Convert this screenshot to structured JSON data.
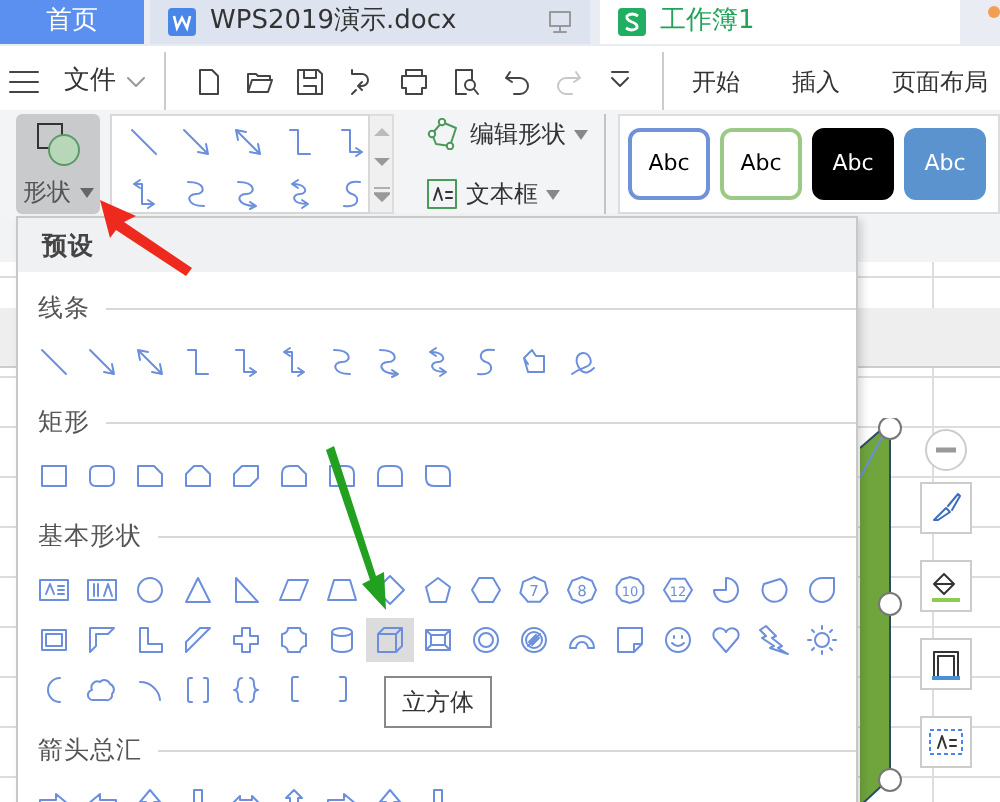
{
  "tabs": [
    {
      "label": "首页",
      "kind": "home",
      "selected": false
    },
    {
      "label": "WPS2019演示.docx",
      "kind": "writer",
      "selected": false
    },
    {
      "label": "工作簿1",
      "kind": "sheet",
      "selected": true
    }
  ],
  "toolbar": {
    "menu_label": "文件",
    "tools": [
      {
        "kind": "new",
        "disabled": false
      },
      {
        "kind": "open",
        "disabled": false
      },
      {
        "kind": "save",
        "disabled": false
      },
      {
        "kind": "convert",
        "disabled": false
      },
      {
        "kind": "print",
        "disabled": false
      },
      {
        "kind": "preview",
        "disabled": false
      },
      {
        "kind": "undo",
        "disabled": false
      },
      {
        "kind": "redo",
        "disabled": true
      },
      {
        "kind": "more",
        "disabled": false
      }
    ],
    "menu_tabs": [
      "开始",
      "插入",
      "页面布局"
    ]
  },
  "ribbon": {
    "shape_button": {
      "label": "形状",
      "selected": true
    },
    "line_gallery": [
      {
        "kind": "line"
      },
      {
        "kind": "arrow"
      },
      {
        "kind": "double-arrow"
      },
      {
        "kind": "elbow"
      },
      {
        "kind": "elbow-arrow"
      },
      {
        "kind": "elbow-double"
      },
      {
        "kind": "curve"
      },
      {
        "kind": "curve-arrow"
      },
      {
        "kind": "curve-double"
      },
      {
        "kind": "s-curve"
      }
    ],
    "edit_shape": "编辑形状",
    "text_box": "文本框",
    "styles": [
      {
        "text": "Abc",
        "kind": "outline",
        "color": "#7191d8"
      },
      {
        "text": "Abc",
        "kind": "outline",
        "color": "#9cc985"
      },
      {
        "text": "Abc",
        "kind": "fill",
        "color": "#000000"
      },
      {
        "text": "Abc",
        "kind": "fill",
        "color": "#5b93cf"
      }
    ]
  },
  "shapes_menu": {
    "header": "预设",
    "sections": [
      {
        "title": "线条",
        "rows": [
          [
            {
              "kind": "line",
              "selected": false
            },
            {
              "kind": "arrow",
              "selected": false
            },
            {
              "kind": "double-arrow",
              "selected": false
            },
            {
              "kind": "elbow",
              "selected": false
            },
            {
              "kind": "elbow-arrow",
              "selected": false
            },
            {
              "kind": "elbow-double",
              "selected": false
            },
            {
              "kind": "curve",
              "selected": false
            },
            {
              "kind": "curve-arrow",
              "selected": false
            },
            {
              "kind": "curve-double",
              "selected": false
            },
            {
              "kind": "s-curve",
              "selected": false
            },
            {
              "kind": "freeform",
              "selected": false
            },
            {
              "kind": "scribble",
              "selected": false
            }
          ]
        ]
      },
      {
        "title": "矩形",
        "rows": [
          [
            {
              "kind": "rect",
              "selected": false
            },
            {
              "kind": "round-rect",
              "selected": false
            },
            {
              "kind": "snip1",
              "selected": false
            },
            {
              "kind": "snip2-same",
              "selected": false
            },
            {
              "kind": "snip2-diag",
              "selected": false
            },
            {
              "kind": "snip-round",
              "selected": false
            },
            {
              "kind": "round1",
              "selected": false
            },
            {
              "kind": "round2-same",
              "selected": false
            },
            {
              "kind": "round2-diag",
              "selected": false
            }
          ]
        ]
      },
      {
        "title": "基本形状",
        "rows": [
          [
            {
              "kind": "text-box",
              "selected": false
            },
            {
              "kind": "vertical-text",
              "selected": false
            },
            {
              "kind": "oval",
              "selected": false
            },
            {
              "kind": "triangle",
              "selected": false
            },
            {
              "kind": "right-triangle",
              "selected": false
            },
            {
              "kind": "parallelogram",
              "selected": false
            },
            {
              "kind": "trapezoid",
              "selected": false
            },
            {
              "kind": "diamond",
              "selected": false
            },
            {
              "kind": "pentagon",
              "selected": false
            },
            {
              "kind": "hexagon",
              "selected": false
            },
            {
              "kind": "heptagon",
              "text": "7",
              "selected": false
            },
            {
              "kind": "octagon",
              "text": "8",
              "selected": false
            },
            {
              "kind": "decagon",
              "text": "10",
              "selected": false
            },
            {
              "kind": "dodecagon",
              "text": "12",
              "selected": false
            },
            {
              "kind": "pie",
              "selected": false
            },
            {
              "kind": "chord",
              "selected": false
            },
            {
              "kind": "teardrop",
              "selected": false
            }
          ],
          [
            {
              "kind": "frame",
              "selected": false
            },
            {
              "kind": "half-frame",
              "selected": false
            },
            {
              "kind": "l-shape",
              "selected": false
            },
            {
              "kind": "diagonal-stripe",
              "selected": false
            },
            {
              "kind": "cross",
              "selected": false
            },
            {
              "kind": "plaque",
              "selected": false
            },
            {
              "kind": "can",
              "selected": false
            },
            {
              "kind": "cube",
              "selected": true
            },
            {
              "kind": "bevel",
              "selected": false
            },
            {
              "kind": "donut",
              "selected": false
            },
            {
              "kind": "no-symbol",
              "selected": false
            },
            {
              "kind": "block-arc",
              "selected": false
            },
            {
              "kind": "folded-corner",
              "selected": false
            },
            {
              "kind": "smiley",
              "selected": false
            },
            {
              "kind": "heart",
              "selected": false
            },
            {
              "kind": "lightning",
              "selected": false
            },
            {
              "kind": "sun",
              "selected": false
            }
          ],
          [
            {
              "kind": "moon",
              "selected": false
            },
            {
              "kind": "cloud",
              "selected": false
            },
            {
              "kind": "arc",
              "selected": false
            },
            {
              "kind": "double-bracket",
              "selected": false
            },
            {
              "kind": "double-brace",
              "selected": false
            },
            {
              "kind": "left-bracket",
              "selected": false
            },
            {
              "kind": "right-bracket",
              "selected": false
            }
          ]
        ]
      },
      {
        "title": "箭头总汇",
        "rows": [
          [
            {
              "kind": "right-arrow",
              "selected": false
            },
            {
              "kind": "left-arrow",
              "selected": false
            },
            {
              "kind": "up-arrow",
              "selected": false
            },
            {
              "kind": "down-arrow",
              "selected": false
            },
            {
              "kind": "left-right-arrow",
              "selected": false
            },
            {
              "kind": "up-down-arrow",
              "selected": false
            },
            {
              "kind": "right-arrow",
              "selected": false
            },
            {
              "kind": "up-arrow",
              "selected": false
            },
            {
              "kind": "down-arrow",
              "selected": false
            }
          ]
        ]
      }
    ]
  },
  "tooltip": "立方体"
}
